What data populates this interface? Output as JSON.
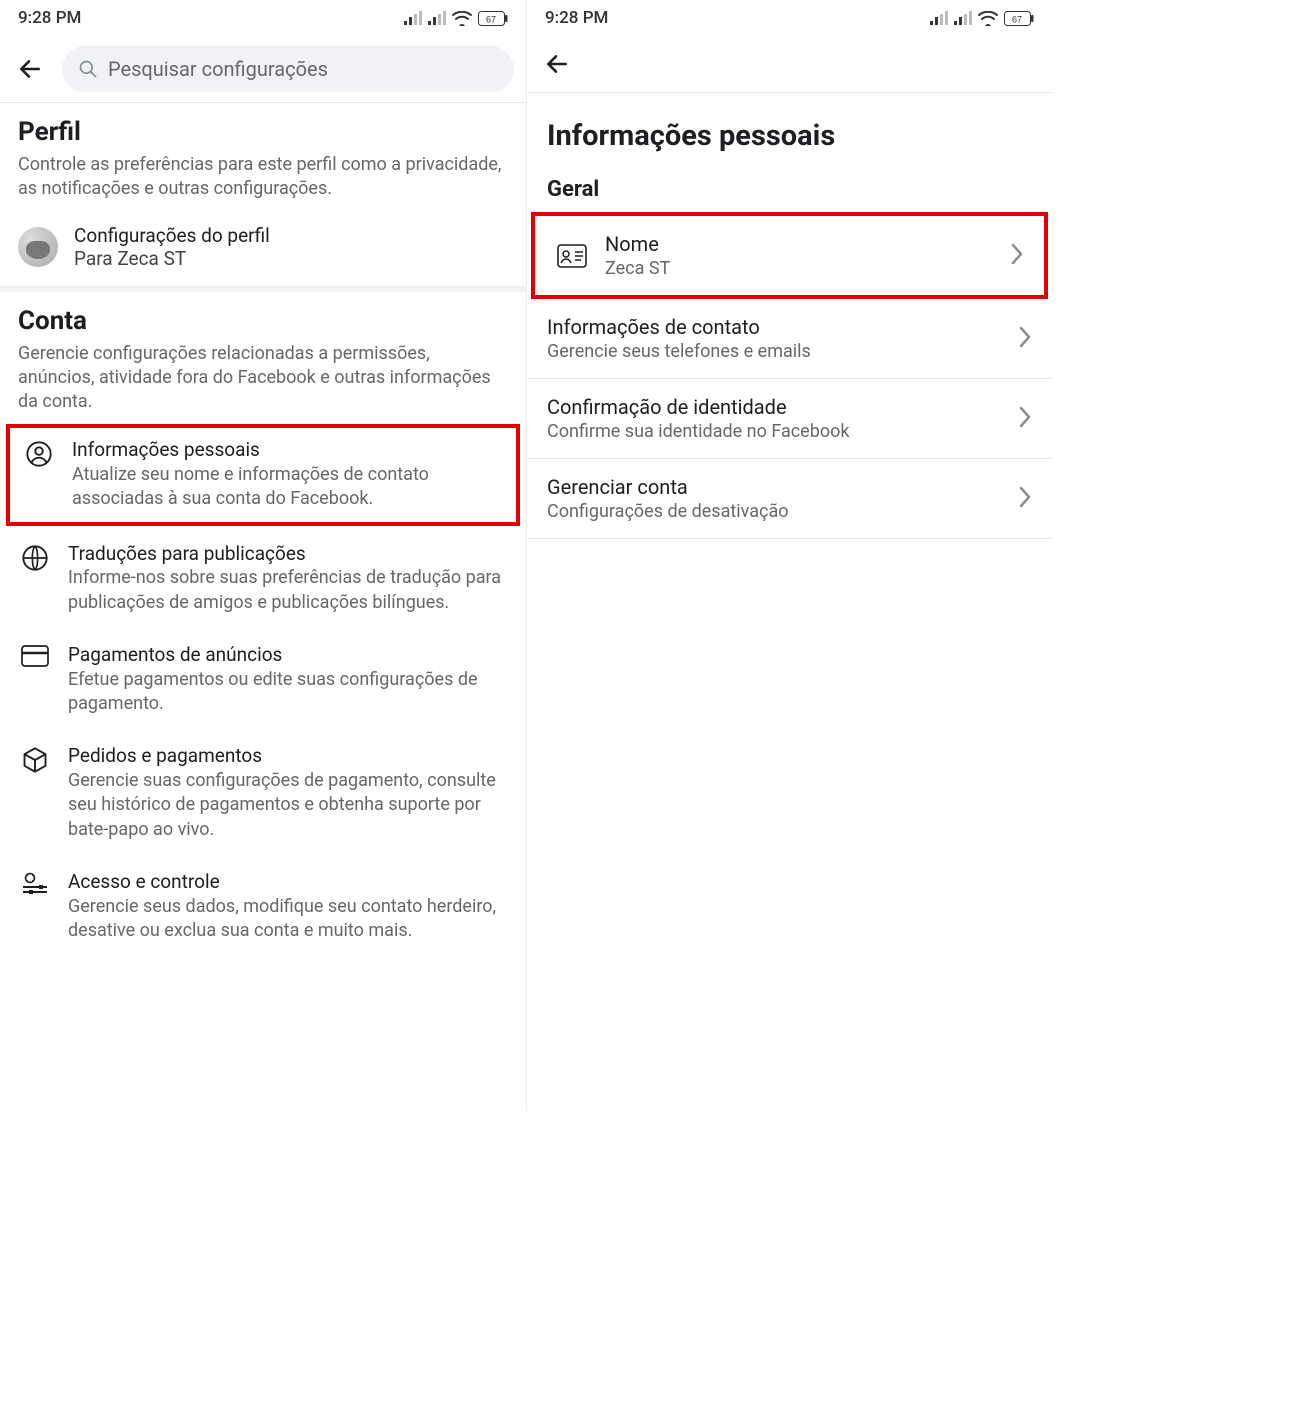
{
  "statusbar": {
    "time": "9:28 PM",
    "battery": "67"
  },
  "left": {
    "search_placeholder": "Pesquisar configurações",
    "perfil": {
      "heading": "Perfil",
      "desc": "Controle as preferências para este perfil como a privacidade, as notificações e outras configurações.",
      "profile_settings_title": "Configurações do perfil",
      "profile_settings_sub": "Para Zeca ST"
    },
    "conta": {
      "heading": "Conta",
      "desc": "Gerencie configurações relacionadas a permissões, anúncios, atividade fora do Facebook e outras informações da conta.",
      "items": [
        {
          "title": "Informações pessoais",
          "desc": "Atualize seu nome e informações de contato associadas à sua conta do Facebook."
        },
        {
          "title": "Traduções para publicações",
          "desc": "Informe-nos sobre suas preferências de tradução para publicações de amigos e publicações bilíngues."
        },
        {
          "title": "Pagamentos de anúncios",
          "desc": "Efetue pagamentos ou edite suas configurações de pagamento."
        },
        {
          "title": "Pedidos e pagamentos",
          "desc": "Gerencie suas configurações de pagamento, consulte seu histórico de pagamentos e obtenha suporte por bate-papo ao vivo."
        },
        {
          "title": "Acesso e controle",
          "desc": "Gerencie seus dados, modifique seu contato herdeiro, desative ou exclua sua conta e muito mais."
        }
      ]
    }
  },
  "right": {
    "title": "Informações pessoais",
    "subhead": "Geral",
    "rows": [
      {
        "title": "Nome",
        "sub": "Zeca ST"
      },
      {
        "title": "Informações de contato",
        "sub": "Gerencie seus telefones e emails"
      },
      {
        "title": "Confirmação de identidade",
        "sub": "Confirme sua identidade no Facebook"
      },
      {
        "title": "Gerenciar conta",
        "sub": "Configurações de desativação"
      }
    ]
  }
}
